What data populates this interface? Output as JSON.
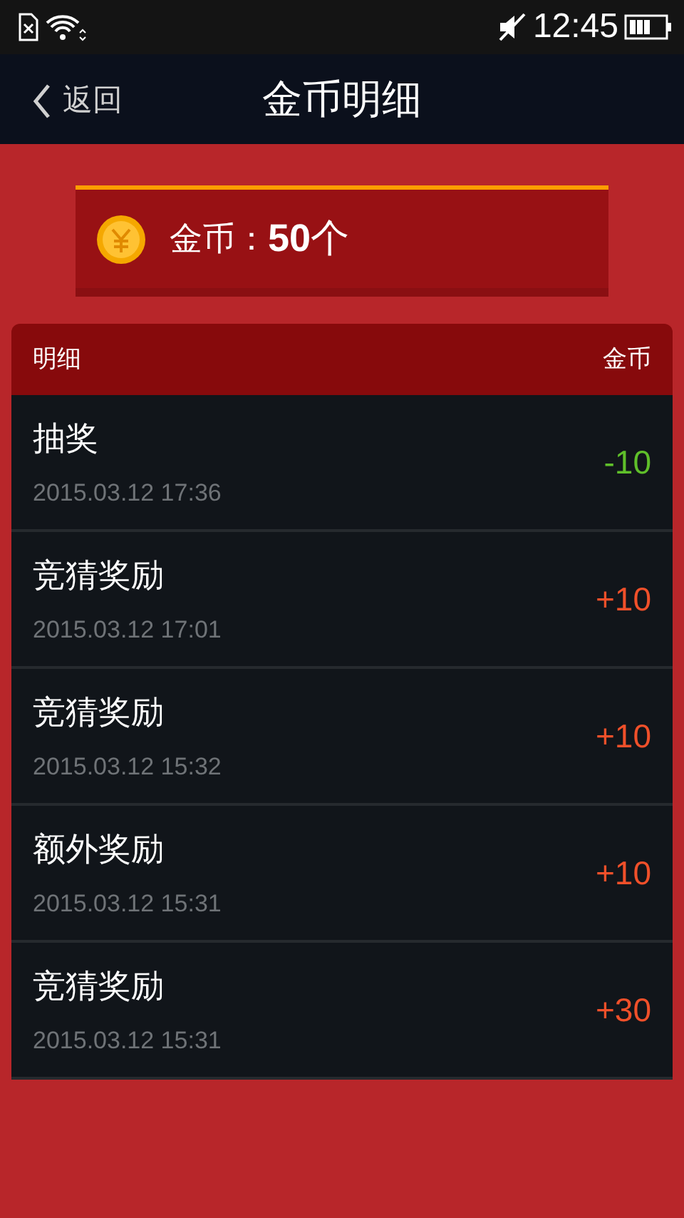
{
  "status_bar": {
    "time": "12:45"
  },
  "header": {
    "back": "返回",
    "title": "金币明细"
  },
  "balance": {
    "label": "金币：",
    "amount": "**50**个"
  },
  "table": {
    "columns": [
      "明细",
      "金币"
    ],
    "rows": [
      {
        "title": "抽奖",
        "time": "2015.03.12 17:36",
        "amount": "-10",
        "kind": "debit"
      },
      {
        "title": "竞猜奖励",
        "time": "2015.03.12 17:01",
        "amount": "+10",
        "kind": "credit"
      },
      {
        "title": "竞猜奖励",
        "time": "2015.03.12 15:32",
        "amount": "+10",
        "kind": "credit"
      },
      {
        "title": "额外奖励",
        "time": "2015.03.12 15:31",
        "amount": "+10",
        "kind": "credit"
      },
      {
        "title": "竞猜奖励",
        "time": "2015.03.12 15:31",
        "amount": "+30",
        "kind": "credit"
      }
    ]
  }
}
